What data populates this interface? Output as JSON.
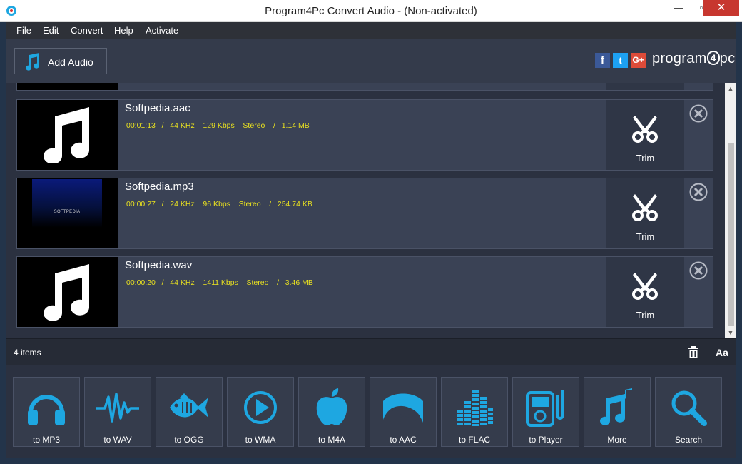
{
  "window": {
    "title": "Program4Pc Convert Audio - (Non-activated)",
    "minimize": "—",
    "maximize": "▫",
    "close": "✕"
  },
  "menu": [
    "File",
    "Edit",
    "Convert",
    "Help",
    "Activate"
  ],
  "toolbar": {
    "add_audio_label": "Add Audio",
    "brand_prefix": "program",
    "brand_num": "4",
    "brand_suffix": "pc",
    "social": [
      "f",
      "t",
      "G+"
    ]
  },
  "items": [
    {
      "filename": "Softpedia.aac",
      "meta": "00:01:13   /   44 KHz    129 Kbps    Stereo    /   1.14 MB",
      "trim_label": "Trim",
      "thumb": "note"
    },
    {
      "filename": "Softpedia.mp3",
      "meta": "00:00:27   /   24 KHz    96 Kbps    Stereo    /   254.74 KB",
      "trim_label": "Trim",
      "thumb": "cover",
      "cover_text": "SOFTPEDIA"
    },
    {
      "filename": "Softpedia.wav",
      "meta": "00:00:20   /   44 KHz    1411 Kbps    Stereo    /   3.46 MB",
      "trim_label": "Trim",
      "thumb": "note"
    }
  ],
  "status": {
    "count": "4  items",
    "font_button": "Aa"
  },
  "convert_buttons": [
    {
      "label": "to MP3",
      "icon": "headphones-icon"
    },
    {
      "label": "to WAV",
      "icon": "waveform-icon"
    },
    {
      "label": "to OGG",
      "icon": "fish-icon"
    },
    {
      "label": "to WMA",
      "icon": "play-circle-icon"
    },
    {
      "label": "to M4A",
      "icon": "apple-icon"
    },
    {
      "label": "to AAC",
      "icon": "aac-waves-icon"
    },
    {
      "label": "to FLAC",
      "icon": "equalizer-icon"
    },
    {
      "label": "to Player",
      "icon": "media-player-icon"
    },
    {
      "label": "More",
      "icon": "music-notes-icon"
    },
    {
      "label": "Search",
      "icon": "search-icon"
    }
  ],
  "colors": {
    "accent": "#1ea7e1",
    "meta_text": "#e8e020",
    "panel": "#3a4255",
    "background": "#2b3140"
  }
}
